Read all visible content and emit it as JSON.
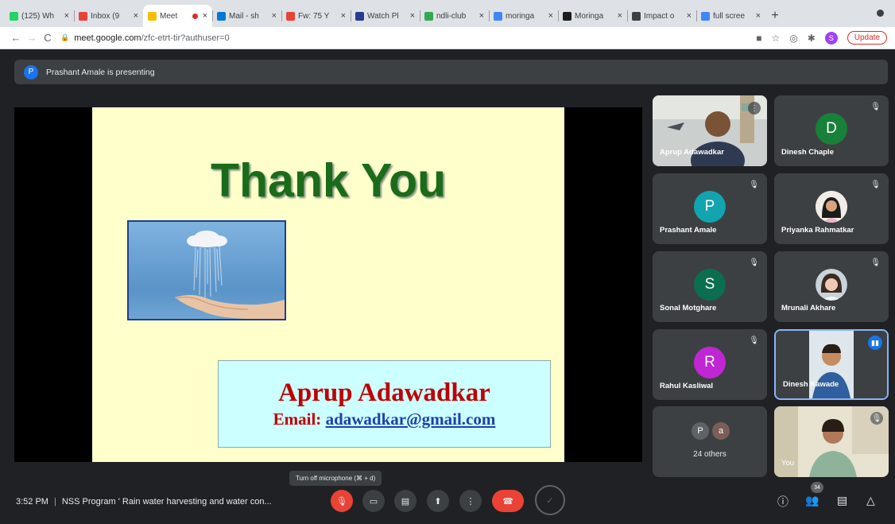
{
  "browser": {
    "tabs": [
      {
        "title": "(125) Wh",
        "favicon_color": "#25d366"
      },
      {
        "title": "Inbox (9",
        "favicon_color": "#ea4335"
      },
      {
        "title": "Meet",
        "favicon_color": "#fbbc04",
        "active": true
      },
      {
        "title": "Mail - sh",
        "favicon_color": "#0078d4"
      },
      {
        "title": "Fw: 75 Y",
        "favicon_color": "#ea4335"
      },
      {
        "title": "Watch Pl",
        "favicon_color": "#2b3a8c"
      },
      {
        "title": "ndli-club",
        "favicon_color": "#34a853"
      },
      {
        "title": "moringa",
        "favicon_color": "#4285f4"
      },
      {
        "title": "Moringa",
        "favicon_color": "#1c1c1c"
      },
      {
        "title": "Impact o",
        "favicon_color": "#3c4043"
      },
      {
        "title": "full scree",
        "favicon_color": "#4285f4"
      }
    ],
    "url_host": "meet.google.com",
    "url_path": "/zfc-etrt-tir?authuser=0",
    "profile_initial": "S",
    "update_label": "Update"
  },
  "presenting_bar": {
    "avatar_initial": "P",
    "text": "Prashant Amale is presenting"
  },
  "slide": {
    "heading": "Thank You",
    "presenter_name": "Aprup Adawadkar",
    "email_label": "Email:",
    "email": "adawadkar@gmail.com"
  },
  "participants": [
    {
      "name": "Aprup Adawadkar",
      "type": "video",
      "muted": false
    },
    {
      "name": "Dinesh Chaple",
      "type": "avatar",
      "initial": "D",
      "color": "#188038",
      "muted": true
    },
    {
      "name": "Prashant Amale",
      "type": "avatar",
      "initial": "P",
      "color": "#12a4af",
      "muted": true
    },
    {
      "name": "Priyanka Rahmatkar",
      "type": "photo",
      "muted": true
    },
    {
      "name": "Sonal Motghare",
      "type": "avatar",
      "initial": "S",
      "color": "#0b6e4f",
      "muted": true
    },
    {
      "name": "Mrunali Akhare",
      "type": "photo",
      "muted": true
    },
    {
      "name": "Rahul Kasliwal",
      "type": "avatar",
      "initial": "R",
      "color": "#c026d3",
      "muted": true
    },
    {
      "name": "Dinesh Kawade",
      "type": "video",
      "speaking": true
    },
    {
      "name": "You",
      "type": "video",
      "muted": true
    }
  ],
  "others": {
    "initials": [
      "P",
      "a"
    ],
    "label": "24 others"
  },
  "tooltip": "Turn off microphone (⌘ + d)",
  "meeting": {
    "time": "3:52 PM",
    "separator": "|",
    "title": "NSS Program ' Rain water harvesting and water con..."
  },
  "people_count": "34",
  "colors": {
    "accent_blue": "#1a73e8",
    "end_call_red": "#ea4335",
    "meet_bg": "#202124"
  }
}
